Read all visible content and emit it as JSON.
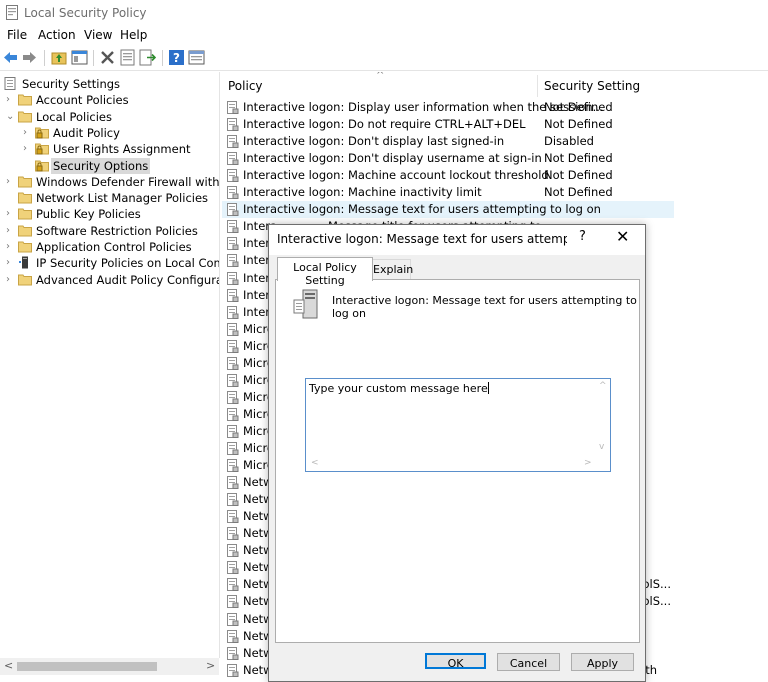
{
  "window": {
    "title": "Local Security Policy"
  },
  "menu": [
    "File",
    "Action",
    "View",
    "Help"
  ],
  "toolbar": [
    "back-icon",
    "forward-icon",
    "up-folder-icon",
    "show-hide-tree-icon",
    "delete-icon",
    "properties-icon",
    "export-list-icon",
    "help-icon",
    "view-icon"
  ],
  "tree": [
    {
      "label": "Security Settings",
      "level": 0,
      "expander": "",
      "icon": "root"
    },
    {
      "label": "Account Policies",
      "level": 1,
      "expander": ">",
      "icon": "folder"
    },
    {
      "label": "Local Policies",
      "level": 1,
      "expander": "v",
      "icon": "folder"
    },
    {
      "label": "Audit Policy",
      "level": 2,
      "expander": ">",
      "icon": "folder-lock"
    },
    {
      "label": "User Rights Assignment",
      "level": 2,
      "expander": ">",
      "icon": "folder-lock"
    },
    {
      "label": "Security Options",
      "level": 2,
      "expander": "",
      "icon": "folder-lock",
      "selected": true
    },
    {
      "label": "Windows Defender Firewall with Adva",
      "level": 1,
      "expander": ">",
      "icon": "folder"
    },
    {
      "label": "Network List Manager Policies",
      "level": 1,
      "expander": "",
      "icon": "folder"
    },
    {
      "label": "Public Key Policies",
      "level": 1,
      "expander": ">",
      "icon": "folder"
    },
    {
      "label": "Software Restriction Policies",
      "level": 1,
      "expander": ">",
      "icon": "folder"
    },
    {
      "label": "Application Control Policies",
      "level": 1,
      "expander": ">",
      "icon": "folder"
    },
    {
      "label": "IP Security Policies on Local Compute",
      "level": 1,
      "expander": ">",
      "icon": "ipsec"
    },
    {
      "label": "Advanced Audit Policy Configuration",
      "level": 1,
      "expander": ">",
      "icon": "folder"
    }
  ],
  "list": {
    "columns": [
      "Policy",
      "Security Setting"
    ],
    "rows": [
      {
        "policy": "Interactive logon: Display user information when the session...",
        "setting": "Not Defined"
      },
      {
        "policy": "Interactive logon: Do not require CTRL+ALT+DEL",
        "setting": "Not Defined"
      },
      {
        "policy": "Interactive logon: Don't display last signed-in",
        "setting": "Disabled"
      },
      {
        "policy": "Interactive logon: Don't display username at sign-in",
        "setting": "Not Defined"
      },
      {
        "policy": "Interactive logon: Machine account lockout threshold",
        "setting": "Not Defined"
      },
      {
        "policy": "Interactive logon: Machine inactivity limit",
        "setting": "Not Defined"
      },
      {
        "policy": "Interactive logon: Message text for users attempting to log on",
        "setting": "",
        "highlight": true
      },
      {
        "policy": "Intera",
        "setting": ""
      },
      {
        "policy": "Intera",
        "setting": ""
      },
      {
        "policy": "Intera",
        "setting": ""
      },
      {
        "policy": "Intera",
        "setting": ""
      },
      {
        "policy": "Intera",
        "setting": ""
      },
      {
        "policy": "Intera",
        "setting": ""
      },
      {
        "policy": "Micro",
        "setting": ""
      },
      {
        "policy": "Micro",
        "setting": ""
      },
      {
        "policy": "Micro",
        "setting": ""
      },
      {
        "policy": "Micro",
        "setting": ""
      },
      {
        "policy": "Micro",
        "setting": ""
      },
      {
        "policy": "Micro",
        "setting": ""
      },
      {
        "policy": "Micro",
        "setting": ""
      },
      {
        "policy": "Micro",
        "setting": ""
      },
      {
        "policy": "Micro",
        "setting": ""
      },
      {
        "policy": "Netw",
        "setting": ""
      },
      {
        "policy": "Netw",
        "setting": ""
      },
      {
        "policy": "Netw",
        "setting": ""
      },
      {
        "policy": "Netw",
        "setting": ""
      },
      {
        "policy": "Netw",
        "setting": ""
      },
      {
        "policy": "Netw",
        "setting": ""
      },
      {
        "policy": "Netw",
        "setting": ""
      },
      {
        "policy": "Netw",
        "setting": ""
      },
      {
        "policy": "Netw",
        "setting": ""
      },
      {
        "policy": "Netw",
        "setting": ""
      },
      {
        "policy": "Netw",
        "setting": ""
      },
      {
        "policy": "Netw",
        "setting": ""
      }
    ],
    "fragments": [
      {
        "row": 7,
        "text": "Message title for users attempting to"
      },
      {
        "row": 28,
        "text": "rolS..."
      },
      {
        "row": 29,
        "text": "rolS..."
      },
      {
        "row": 33,
        "text": "uth"
      }
    ]
  },
  "dialog": {
    "title": "Interactive logon: Message text for users attempting to lo...",
    "help": "?",
    "close": "✕",
    "tabs": [
      "Local Policy Setting",
      "Explain"
    ],
    "description": "Interactive logon: Message text for users attempting to log on",
    "message_value": "Type your custom message here",
    "buttons": {
      "ok": "OK",
      "cancel": "Cancel",
      "apply": "Apply"
    }
  },
  "colors": {
    "selection": "#d9d9d9",
    "row_highlight": "#e5f3fb",
    "focus": "#0078d7",
    "input_border": "#5a8fcb"
  }
}
